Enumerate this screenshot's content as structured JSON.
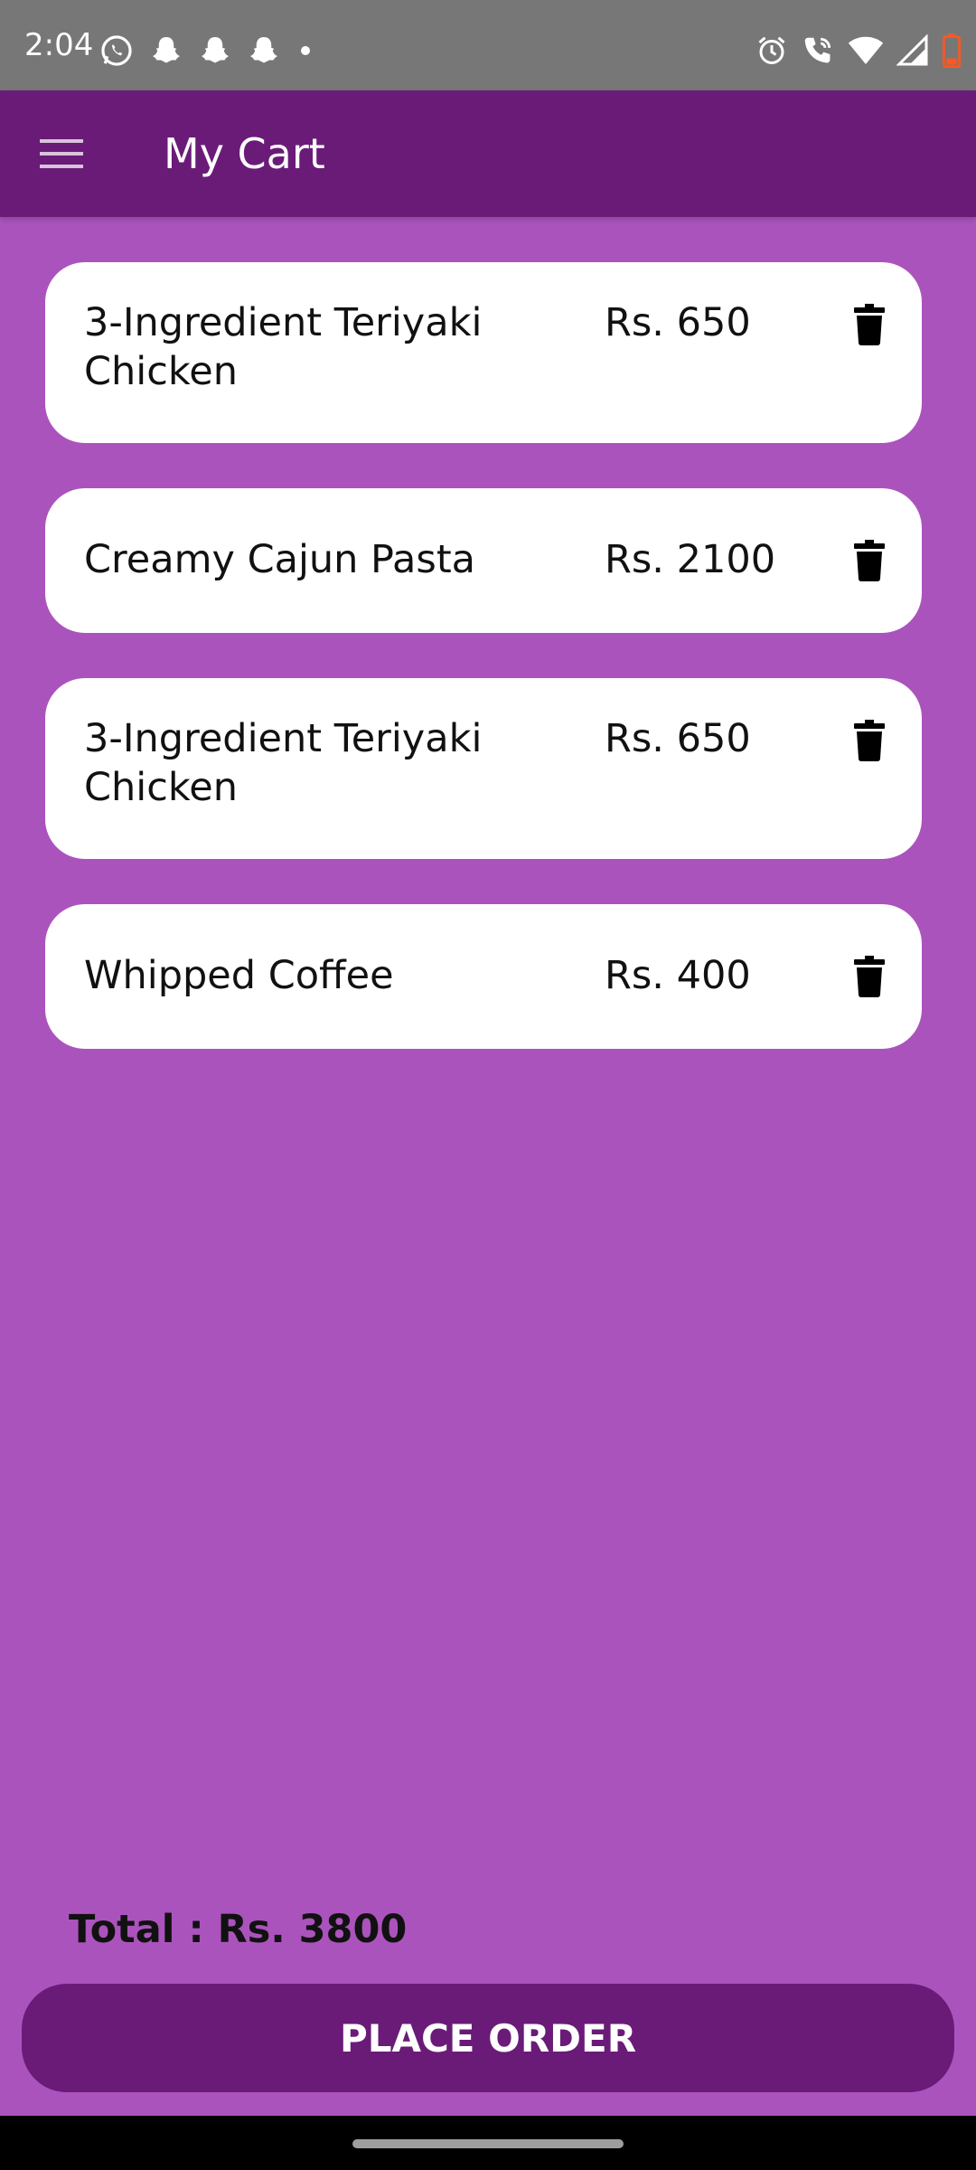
{
  "status_bar": {
    "time": "2:04",
    "left_icons": [
      "whatsapp-icon",
      "snapchat-icon",
      "snapchat-icon",
      "snapchat-icon",
      "dot-icon"
    ],
    "right_icons": [
      "alarm-icon",
      "wifi-calling-icon",
      "wifi-icon",
      "signal-icon",
      "battery-icon"
    ],
    "battery_level": 0.2,
    "battery_color": "#ff5722"
  },
  "app_bar": {
    "title": "My Cart",
    "menu_icon": "hamburger-menu-icon"
  },
  "cart": {
    "items": [
      {
        "name": "3-Ingredient Teriyaki Chicken",
        "price": "Rs. 650"
      },
      {
        "name": "Creamy Cajun Pasta",
        "price": "Rs. 2100"
      },
      {
        "name": "3-Ingredient Teriyaki Chicken",
        "price": "Rs. 650"
      },
      {
        "name": "Whipped Coffee",
        "price": "Rs. 400"
      }
    ],
    "delete_icon": "trash-icon"
  },
  "total_label": "Total : Rs. 3800",
  "place_order_label": "PLACE ORDER",
  "colors": {
    "background": "#ab53bd",
    "primary_dark": "#6a1b78",
    "card": "#ffffff",
    "status_bar": "#777777"
  }
}
